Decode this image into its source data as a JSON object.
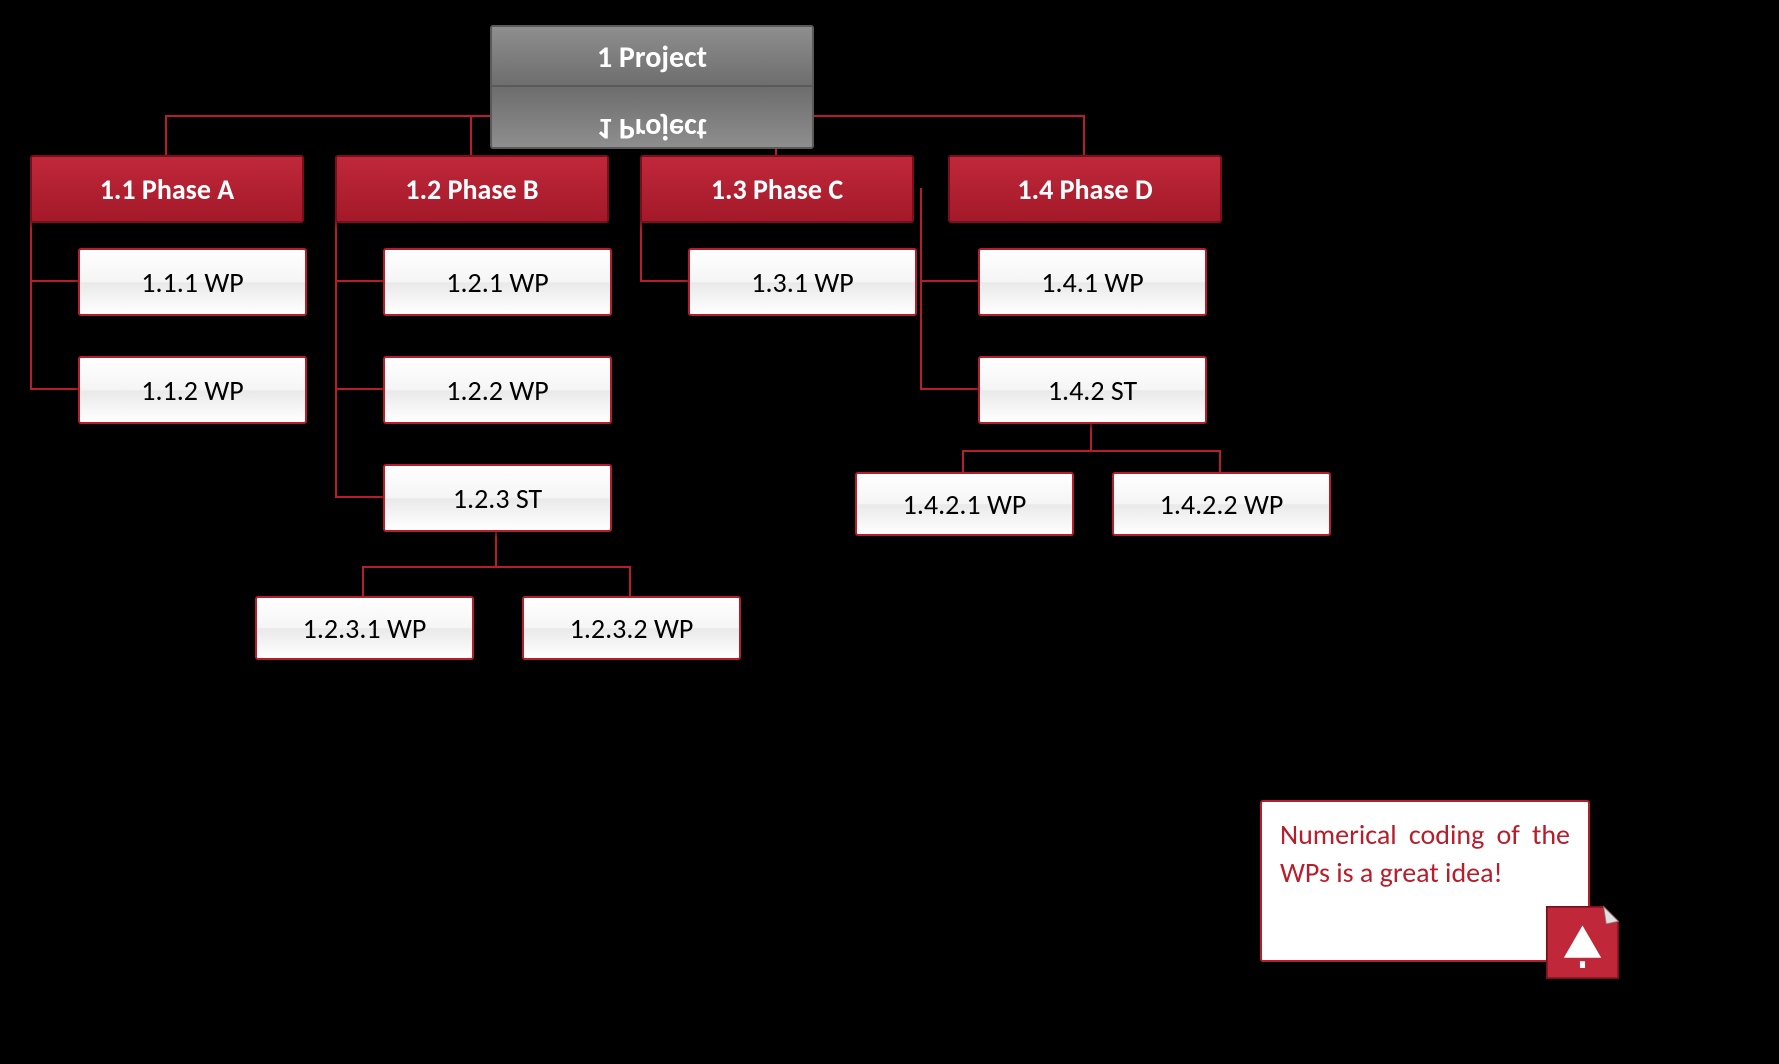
{
  "root": {
    "label": "1 Project",
    "mirror": "1 Project"
  },
  "phases": [
    {
      "label": "1.1 Phase A"
    },
    {
      "label": "1.2 Phase B"
    },
    {
      "label": "1.3 Phase C"
    },
    {
      "label": "1.4 Phase D"
    }
  ],
  "p0": {
    "wp1": "1.1.1 WP",
    "wp2": "1.1.2 WP"
  },
  "p1": {
    "wp1": "1.2.1 WP",
    "wp2": "1.2.2 WP",
    "st": "1.2.3 ST",
    "sub1": "1.2.3.1 WP",
    "sub2": "1.2.3.2 WP"
  },
  "p2": {
    "wp1": "1.3.1 WP"
  },
  "p3": {
    "wp1": "1.4.1 WP",
    "st": "1.4.2 ST",
    "sub1": "1.4.2.1 WP",
    "sub2": "1.4.2.2 WP"
  },
  "note": "Numerical coding of the WPs is a great idea!",
  "colors": {
    "accent": "#b81d2b",
    "phase": "#a31929",
    "root": "#6d6d6d"
  }
}
